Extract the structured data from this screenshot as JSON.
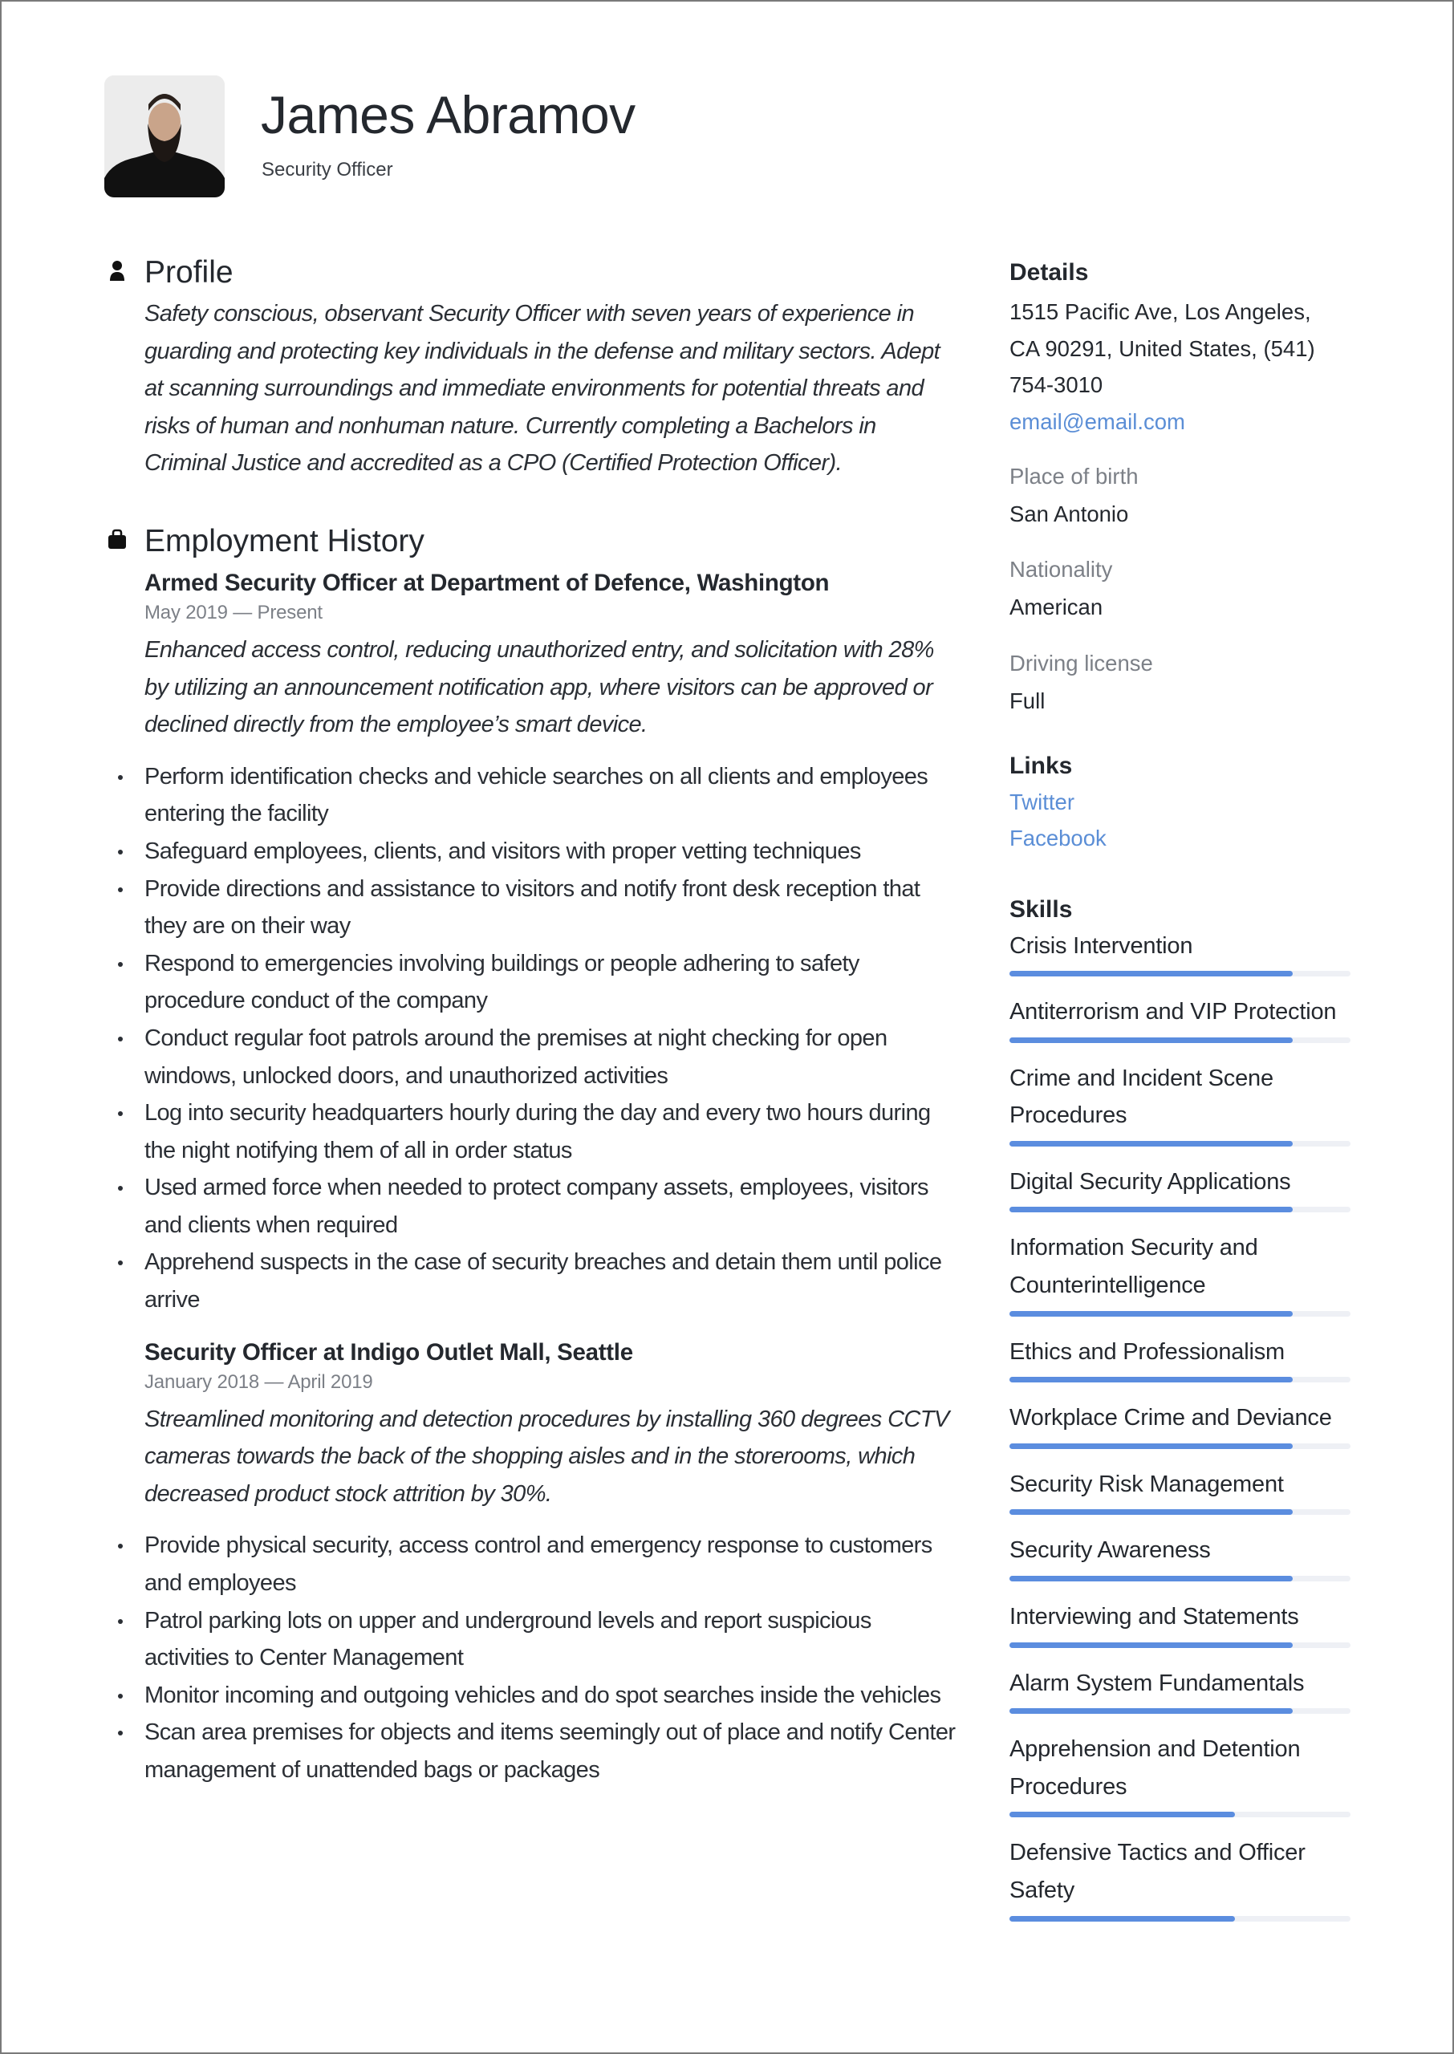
{
  "header": {
    "name": "James Abramov",
    "job_title": "Security Officer",
    "photo_alt": "portrait-photo"
  },
  "profile": {
    "title": "Profile",
    "icon": "person-icon",
    "text": "Safety conscious, observant Security Officer with seven years of experience in guarding and protecting key individuals in the defense and military sectors. Adept at scanning surroundings and immediate environments for potential threats and risks of human and nonhuman nature. Currently completing a Bachelors in Criminal Justice and accredited as a CPO (Certified Protection Officer)."
  },
  "employment": {
    "title": "Employment History",
    "icon": "briefcase-icon",
    "jobs": [
      {
        "heading": "Armed Security Officer at  Department of Defence, Washington",
        "dates": "May 2019 — Present",
        "summary": "Enhanced access control, reducing unauthorized entry, and solicitation with 28% by utilizing an announcement notification app, where visitors can be approved or declined directly from the employee’s smart device.",
        "bullets": [
          "Perform identification checks and vehicle searches on all clients and employees entering the facility",
          "Safeguard employees, clients, and visitors with proper vetting techniques",
          "Provide directions and assistance to visitors and notify front desk reception that they are on their way",
          "Respond to emergencies involving buildings or people adhering to safety procedure conduct of the company",
          "Conduct regular foot patrols around the premises at night checking for open windows, unlocked doors, and unauthorized activities",
          "Log into security headquarters hourly during the day and every two hours during the night notifying them of all in order status",
          "Used armed force when needed to protect company assets, employees, visitors and clients when required",
          "Apprehend suspects in the case of security breaches and detain them until police arrive"
        ]
      },
      {
        "heading": "Security Officer at  Indigo Outlet Mall, Seattle",
        "dates": "January 2018 — April 2019",
        "summary": "Streamlined monitoring and detection procedures by installing 360 degrees CCTV cameras towards the back of the shopping aisles and in the storerooms, which decreased product stock attrition by 30%.",
        "bullets": [
          "Provide physical security, access control and emergency response to customers and employees",
          "Patrol parking lots on upper and underground levels and report suspicious activities to Center Management",
          "Monitor incoming and outgoing vehicles and do spot searches inside the vehicles",
          "Scan area premises for objects and items seemingly out of place and notify Center management of unattended bags or packages"
        ]
      }
    ]
  },
  "details": {
    "title": "Details",
    "address_lines": [
      "1515 Pacific Ave, Los Angeles,",
      "CA 90291, United States, (541)",
      "754-3010"
    ],
    "email": "email@email.com",
    "place_of_birth_label": "Place of birth",
    "place_of_birth": "San Antonio",
    "nationality_label": "Nationality",
    "nationality": "American",
    "driving_license_label": "Driving license",
    "driving_license": "Full"
  },
  "links": {
    "title": "Links",
    "items": [
      {
        "label": "Twitter"
      },
      {
        "label": "Facebook"
      }
    ]
  },
  "skills": {
    "title": "Skills",
    "items": [
      {
        "name": "Crisis Intervention",
        "level_pct": 83
      },
      {
        "name": "Antiterrorism and VIP Protection",
        "level_pct": 83
      },
      {
        "name": "Crime and Incident Scene Procedures",
        "level_pct": 83
      },
      {
        "name": "Digital Security Applications",
        "level_pct": 83
      },
      {
        "name": "Information Security and Counterintelligence",
        "level_pct": 83
      },
      {
        "name": "Ethics and Professionalism",
        "level_pct": 83
      },
      {
        "name": "Workplace Crime and Deviance",
        "level_pct": 83
      },
      {
        "name": "Security Risk Management",
        "level_pct": 83
      },
      {
        "name": "Security Awareness",
        "level_pct": 83
      },
      {
        "name": "Interviewing and Statements",
        "level_pct": 83
      },
      {
        "name": "Alarm System Fundamentals",
        "level_pct": 83
      },
      {
        "name": "Apprehension and Detention Procedures",
        "level_pct": 66
      },
      {
        "name": "Defensive Tactics and Officer Safety",
        "level_pct": 66
      }
    ]
  },
  "colors": {
    "accent": "#5b8ddf",
    "link": "#5b8ed6",
    "text": "#24282e",
    "muted": "#7c8087",
    "track": "#eef0f5"
  }
}
